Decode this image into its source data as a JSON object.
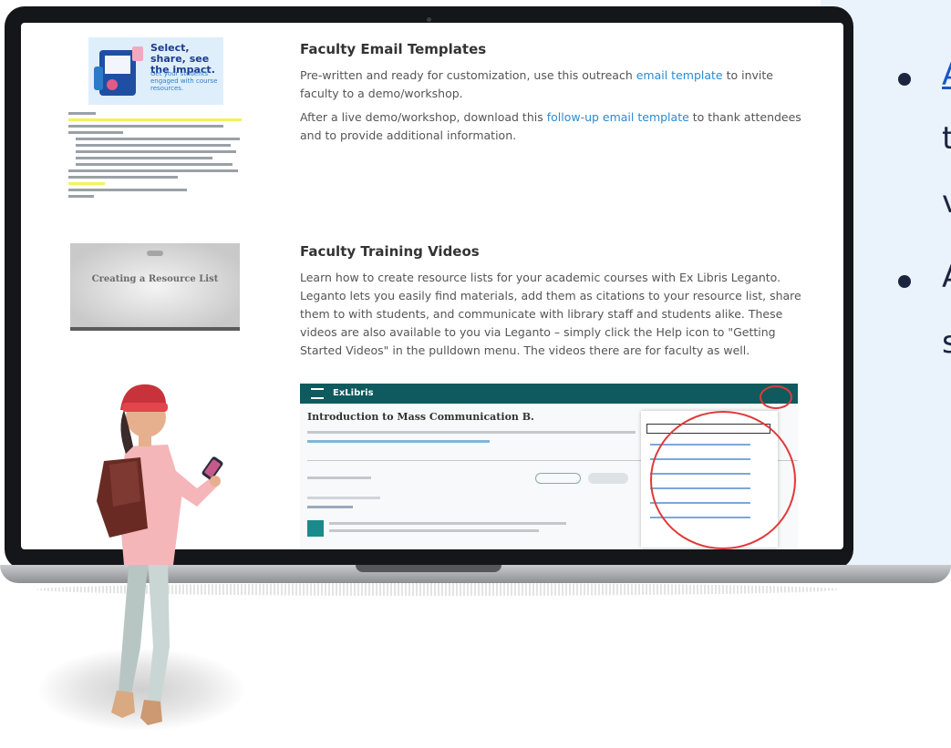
{
  "slide": {
    "bullets": [
      {
        "fragment": "A",
        "is_link": true
      },
      {
        "fragment": "t",
        "is_link": false
      },
      {
        "fragment": "v",
        "is_link": false
      },
      {
        "fragment": "A",
        "is_link": false
      },
      {
        "fragment": "s",
        "is_link": false
      }
    ]
  },
  "page": {
    "email_section": {
      "title": "Faculty Email Templates",
      "para1_before": "Pre-written and ready for customization, use this outreach ",
      "para1_link": "email template",
      "para1_after": " to invite faculty to a demo/workshop.",
      "para2_before": "After a live demo/workshop, download this ",
      "para2_link": "follow-up email template",
      "para2_after": " to thank attendees and to provide additional information."
    },
    "email_thumbnail": {
      "title": "Select, share, see the impact.",
      "subtitle": "Get your students engaged with course resources."
    },
    "video_section": {
      "title": "Faculty Training Videos",
      "body": "Learn how to create resource lists for your academic courses with Ex Libris Leganto. Leganto lets you easily find materials, add them as citations to your resource list, share them to with students, and communicate with library staff and students alike. These videos are also available to you via Leganto – simply click the Help icon to \"Getting Started Videos\" in the pulldown menu. The videos there are for faculty as well."
    },
    "video_thumbnail": {
      "title": "Creating a Resource List"
    },
    "leganto_screenshot": {
      "brand": "ExLibris",
      "course_title": "Introduction to Mass Communication B."
    }
  },
  "colors": {
    "link": "#2a8bd3",
    "leganto_header": "#0e5a5e",
    "highlight_circle": "#e03a3a",
    "slide_background": "#eaf3fc"
  }
}
